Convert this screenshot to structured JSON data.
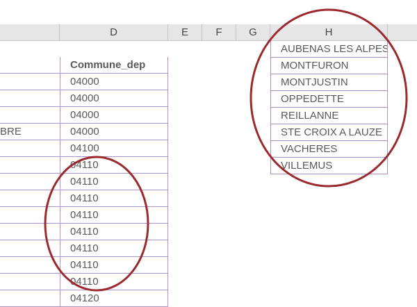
{
  "column_headers": [
    "D",
    "E",
    "F",
    "G",
    "H"
  ],
  "column_d": {
    "header": "Commune_dep",
    "values": [
      "04000",
      "04000",
      "04000",
      "04000",
      "04100",
      "04110",
      "04110",
      "04110",
      "04110",
      "04110",
      "04110",
      "04110",
      "04110",
      "04120"
    ]
  },
  "column_a_partial": {
    "values": [
      "",
      "",
      "",
      "BRE",
      "",
      "",
      "",
      "",
      "",
      "",
      "",
      "",
      "",
      ""
    ]
  },
  "column_h": {
    "values": [
      "AUBENAS LES ALPES",
      "MONTFURON",
      "MONTJUSTIN",
      "OPPEDETTE",
      "REILLANNE",
      "STE CROIX A LAUZE",
      "VACHERES",
      "VILLEMUS"
    ]
  },
  "annotation_color": "#9a2a2e",
  "grid_border_color": "#b48fcf",
  "header_bg": "#e6e6e6"
}
